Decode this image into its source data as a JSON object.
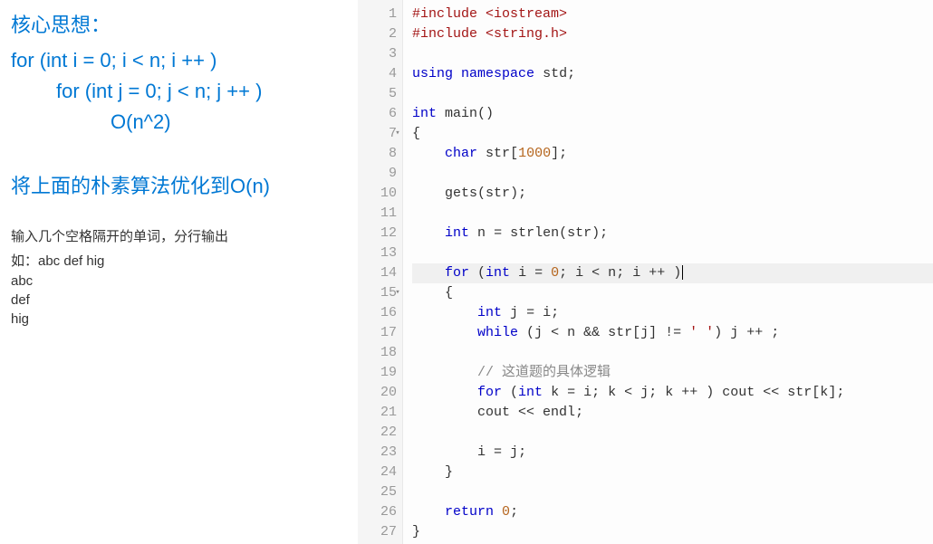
{
  "left": {
    "core_title": "核心思想：",
    "core_line1": "for (int i = 0; i < n; i ++ )",
    "core_line2": "for (int j = 0; j < n; j ++ )",
    "core_line3": "O(n^2)",
    "opt_line": "将上面的朴素算法优化到O(n)",
    "desc": "输入几个空格隔开的单词，分行输出",
    "ex1": "如：abc def hig",
    "ex2": "abc",
    "ex3": "def",
    "ex4": "hig"
  },
  "code": {
    "lines": [
      {
        "n": 1,
        "fold": false,
        "hl": false
      },
      {
        "n": 2,
        "fold": false,
        "hl": false
      },
      {
        "n": 3,
        "fold": false,
        "hl": false
      },
      {
        "n": 4,
        "fold": false,
        "hl": false
      },
      {
        "n": 5,
        "fold": false,
        "hl": false
      },
      {
        "n": 6,
        "fold": false,
        "hl": false
      },
      {
        "n": 7,
        "fold": true,
        "hl": false
      },
      {
        "n": 8,
        "fold": false,
        "hl": false
      },
      {
        "n": 9,
        "fold": false,
        "hl": false
      },
      {
        "n": 10,
        "fold": false,
        "hl": false
      },
      {
        "n": 11,
        "fold": false,
        "hl": false
      },
      {
        "n": 12,
        "fold": false,
        "hl": false
      },
      {
        "n": 13,
        "fold": false,
        "hl": false
      },
      {
        "n": 14,
        "fold": false,
        "hl": true
      },
      {
        "n": 15,
        "fold": true,
        "hl": false
      },
      {
        "n": 16,
        "fold": false,
        "hl": false
      },
      {
        "n": 17,
        "fold": false,
        "hl": false
      },
      {
        "n": 18,
        "fold": false,
        "hl": false
      },
      {
        "n": 19,
        "fold": false,
        "hl": false
      },
      {
        "n": 20,
        "fold": false,
        "hl": false
      },
      {
        "n": 21,
        "fold": false,
        "hl": false
      },
      {
        "n": 22,
        "fold": false,
        "hl": false
      },
      {
        "n": 23,
        "fold": false,
        "hl": false
      },
      {
        "n": 24,
        "fold": false,
        "hl": false
      },
      {
        "n": 25,
        "fold": false,
        "hl": false
      },
      {
        "n": 26,
        "fold": false,
        "hl": false
      },
      {
        "n": 27,
        "fold": false,
        "hl": false
      }
    ],
    "tokens": {
      "include": "#include",
      "iostream": "<iostream>",
      "stringh": "<string.h>",
      "using": "using",
      "namespace": "namespace",
      "std": "std",
      "int": "int",
      "main": "main",
      "char": "char",
      "str": "str",
      "n1000": "1000",
      "gets": "gets",
      "n": "n",
      "strlen": "strlen",
      "for": "for",
      "i": "i",
      "zero": "0",
      "j": "j",
      "while": "while",
      "space": "' '",
      "comment": "// 这道题的具体逻辑",
      "k": "k",
      "cout": "cout",
      "endl": "endl",
      "return": "return"
    }
  }
}
